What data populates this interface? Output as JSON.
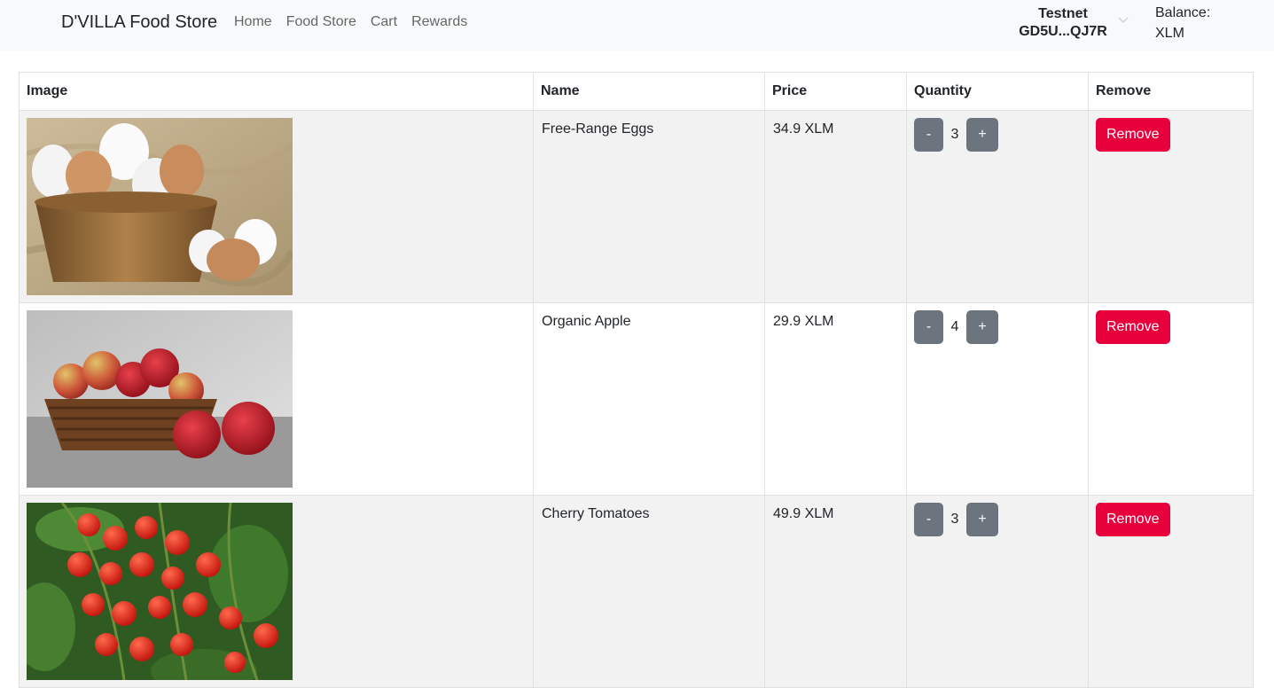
{
  "nav": {
    "brand": "D'VILLA Food Store",
    "links": [
      "Home",
      "Food Store",
      "Cart",
      "Rewards"
    ],
    "wallet_network": "Testnet",
    "wallet_address": "GD5U...QJ7R",
    "balance_label": "Balance:",
    "balance_unit": "XLM"
  },
  "table": {
    "headers": [
      "Image",
      "Name",
      "Price",
      "Quantity",
      "Remove"
    ],
    "rows": [
      {
        "image": "eggs-in-basket",
        "name": "Free-Range Eggs",
        "price": "34.9 XLM",
        "qty": "3",
        "minus": "-",
        "plus": "+",
        "remove": "Remove"
      },
      {
        "image": "apples-in-basket",
        "name": "Organic Apple",
        "price": "29.9 XLM",
        "qty": "4",
        "minus": "-",
        "plus": "+",
        "remove": "Remove"
      },
      {
        "image": "cherry-tomatoes-on-vine",
        "name": "Cherry Tomatoes",
        "price": "49.9 XLM",
        "qty": "3",
        "minus": "-",
        "plus": "+",
        "remove": "Remove"
      }
    ]
  },
  "colors": {
    "navbar_bg": "#f8f9fa",
    "striped_row": "#f2f2f2",
    "qty_button": "#6c757d",
    "remove_button": "#e8003d"
  }
}
